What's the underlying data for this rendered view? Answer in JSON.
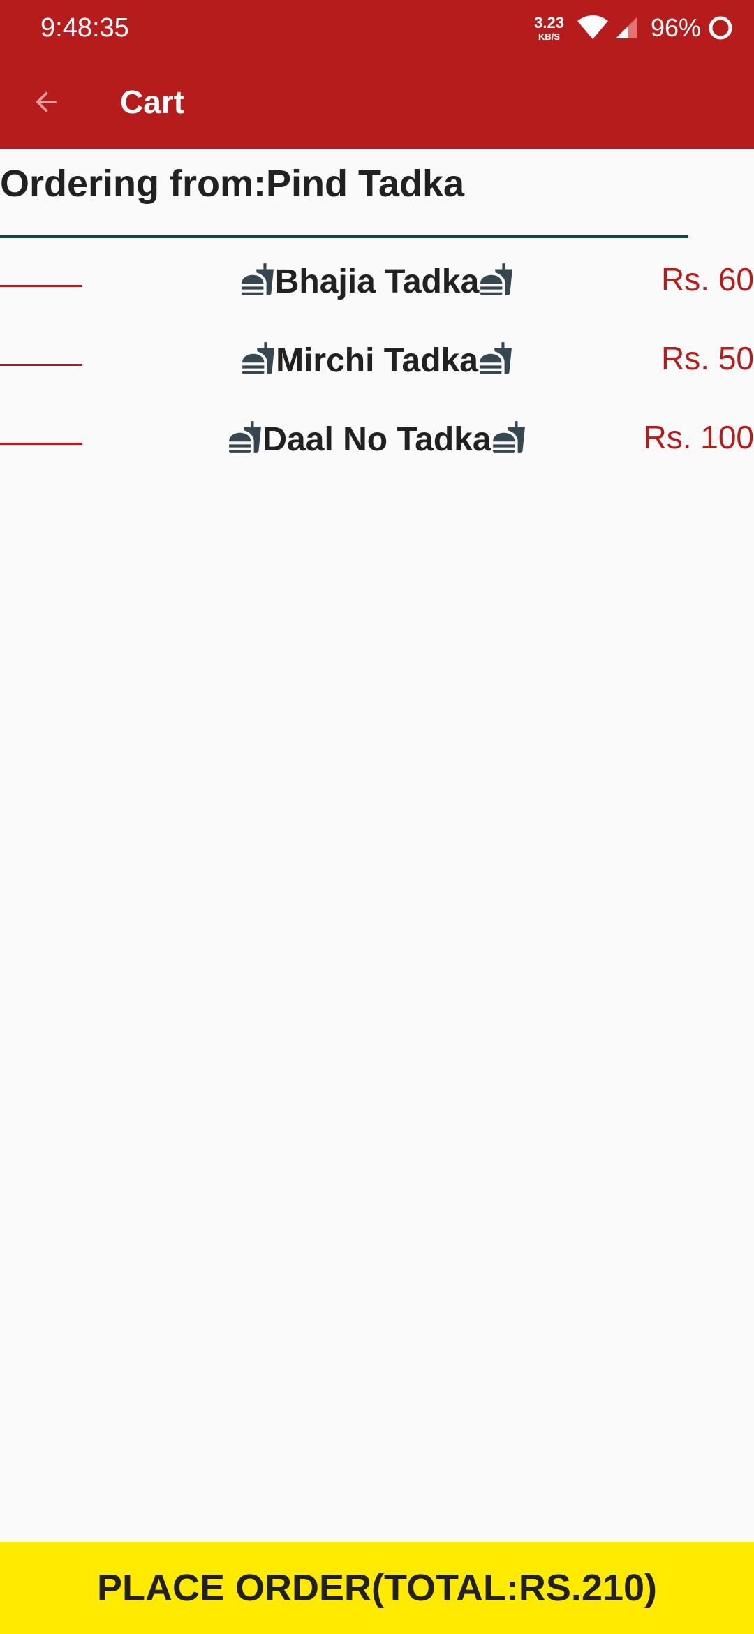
{
  "status_bar": {
    "time": "9:48:35",
    "net_speed_value": "3.23",
    "net_speed_unit": "KB/S",
    "battery_percent": "96%"
  },
  "app_bar": {
    "title": "Cart",
    "back_icon": "arrow-back-icon"
  },
  "order": {
    "ordering_from": "Ordering from:Pind Tadka",
    "items": [
      {
        "name": "Bhajia Tadka",
        "price": "Rs. 60"
      },
      {
        "name": "Mirchi Tadka",
        "price": "Rs. 50"
      },
      {
        "name": "Daal No Tadka",
        "price": "Rs. 100"
      }
    ]
  },
  "footer": {
    "place_order_label": "PLACE ORDER(TOTAL:RS.210)"
  },
  "colors": {
    "primary": "#b71c1c",
    "accent": "#ffea00",
    "divider": "#0b4a3c",
    "background": "#fafafa",
    "text": "#212121"
  },
  "icons": {
    "item_icon": "fastfood-icon"
  }
}
